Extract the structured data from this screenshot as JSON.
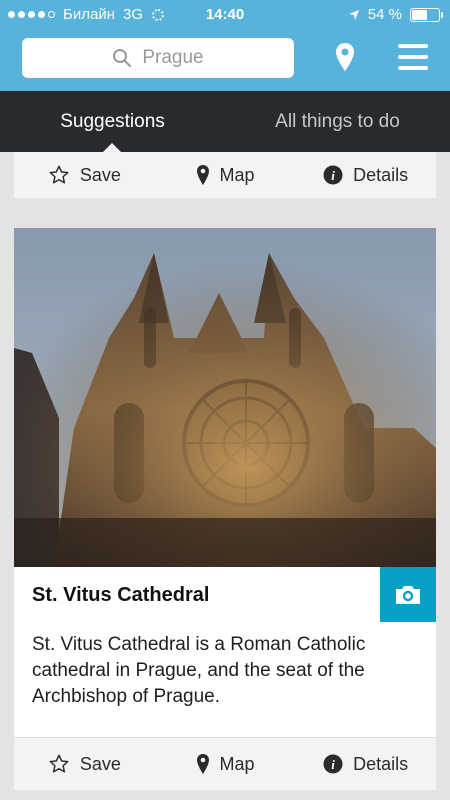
{
  "status_bar": {
    "carrier": "Билайн",
    "network": "3G",
    "time": "14:40",
    "battery_percent": "54 %",
    "battery_level": 0.54
  },
  "search": {
    "value": "Prague",
    "icon": "search-icon"
  },
  "header_icons": {
    "location": "map-pin-icon",
    "menu": "hamburger-menu-icon"
  },
  "tabs": [
    {
      "label": "Suggestions",
      "active": true
    },
    {
      "label": "All things to do",
      "active": false
    }
  ],
  "actions_top": {
    "save": "Save",
    "map": "Map",
    "details": "Details"
  },
  "card": {
    "title": "St. Vitus Cathedral",
    "description": "St. Vitus Cathedral is a Roman Catholic cathedral in Prague, and the seat of the Archbishop of Prague.",
    "camera_icon": "camera-icon"
  },
  "actions_bottom": {
    "save": "Save",
    "map": "Map",
    "details": "Details"
  },
  "colors": {
    "header_blue": "#57b2dc",
    "tab_dark": "#272a2f",
    "accent_teal": "#0aa0c6"
  }
}
